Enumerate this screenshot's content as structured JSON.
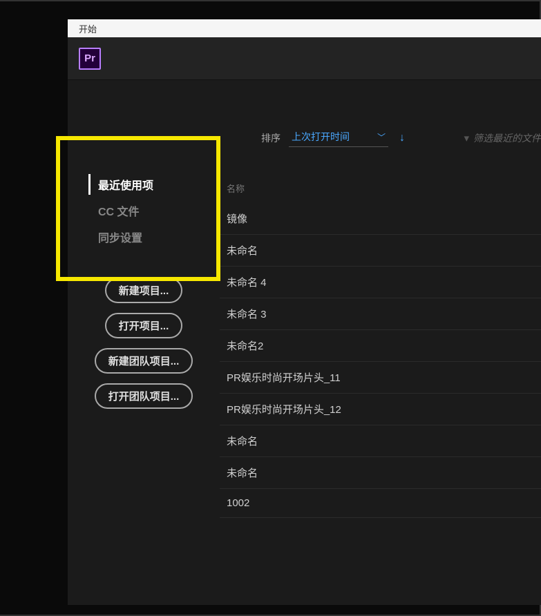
{
  "titlebar": {
    "label": "开始"
  },
  "logo": {
    "text": "Pr"
  },
  "sidebar": {
    "nav": [
      {
        "label": "最近使用项",
        "active": true
      },
      {
        "label": "CC 文件",
        "active": false
      },
      {
        "label": "同步设置",
        "active": false
      }
    ],
    "buttons": [
      {
        "label": "新建项目..."
      },
      {
        "label": "打开项目..."
      },
      {
        "label": "新建团队项目..."
      },
      {
        "label": "打开团队项目..."
      }
    ]
  },
  "sort": {
    "label": "排序",
    "value": "上次打开时间"
  },
  "filter": {
    "placeholder": "筛选最近的文件"
  },
  "list_header": {
    "name": "名称"
  },
  "recent_items": [
    {
      "name": "镜像"
    },
    {
      "name": "未命名"
    },
    {
      "name": "未命名 4"
    },
    {
      "name": "未命名 3"
    },
    {
      "name": "未命名2"
    },
    {
      "name": "PR娱乐时尚开场片头_11"
    },
    {
      "name": "PR娱乐时尚开场片头_12"
    },
    {
      "name": "未命名"
    },
    {
      "name": "未命名"
    },
    {
      "name": "1002"
    }
  ]
}
